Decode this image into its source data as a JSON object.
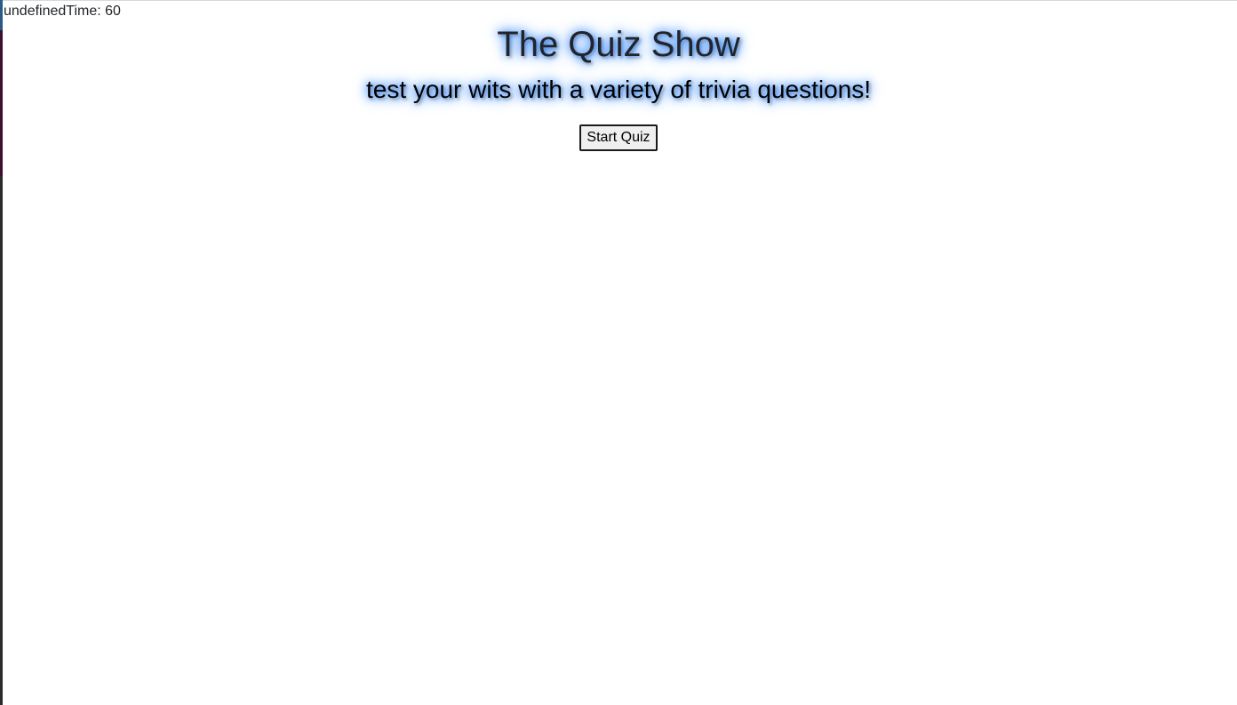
{
  "timer": {
    "text": "undefinedTime: 60"
  },
  "hero": {
    "title": "The Quiz Show",
    "subtitle": "test your wits with a variety of trivia questions!",
    "start_label": "Start Quiz"
  },
  "colors": {
    "glow": "#0d6efd",
    "text": "#212529",
    "background": "#ffffff"
  }
}
